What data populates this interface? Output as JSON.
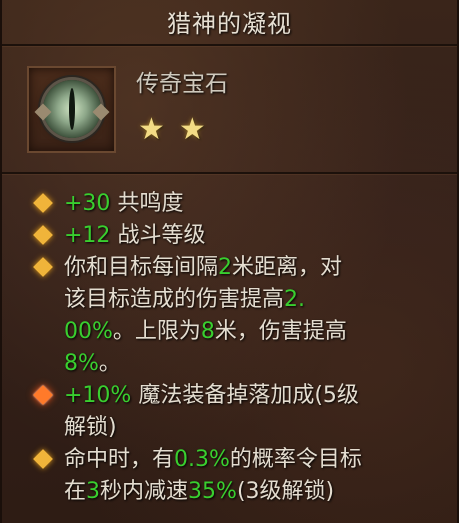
{
  "item": {
    "name": "猎神的凝视",
    "rarity": "传奇宝石",
    "stars": [
      "★",
      "★"
    ],
    "icon": "eye-gem-icon"
  },
  "affixes": {
    "a1": {
      "value": "+30",
      "text": "共鸣度"
    },
    "a2": {
      "value": "+12",
      "text": "战斗等级"
    },
    "a3": {
      "l1a": "你和目标每间隔",
      "l1v": "2",
      "l1b": "米距离，对",
      "l2a": "该目标造成的伤害提高",
      "l2v": "2.",
      "l3v": "00%",
      "l3a": "。上限为",
      "l3v2": "8",
      "l3b": "米，伤害提高",
      "l4v": "8%",
      "l4a": "。"
    },
    "a4": {
      "value": "+10%",
      "l1": "魔法装备掉落加成(5级",
      "l2": "解锁)"
    },
    "a5": {
      "l1a": "命中时，有",
      "l1v": "0.3%",
      "l1b": "的概率令目标",
      "l2a": "在",
      "l2v": "3",
      "l2b": "秒内减速",
      "l2v2": "35%",
      "l2c": "(3级解锁)"
    }
  },
  "colors": {
    "highlight": "#39cf2f",
    "text": "#e4ddd0",
    "star": "#f3dc85",
    "bullet": "#f0b43a"
  }
}
